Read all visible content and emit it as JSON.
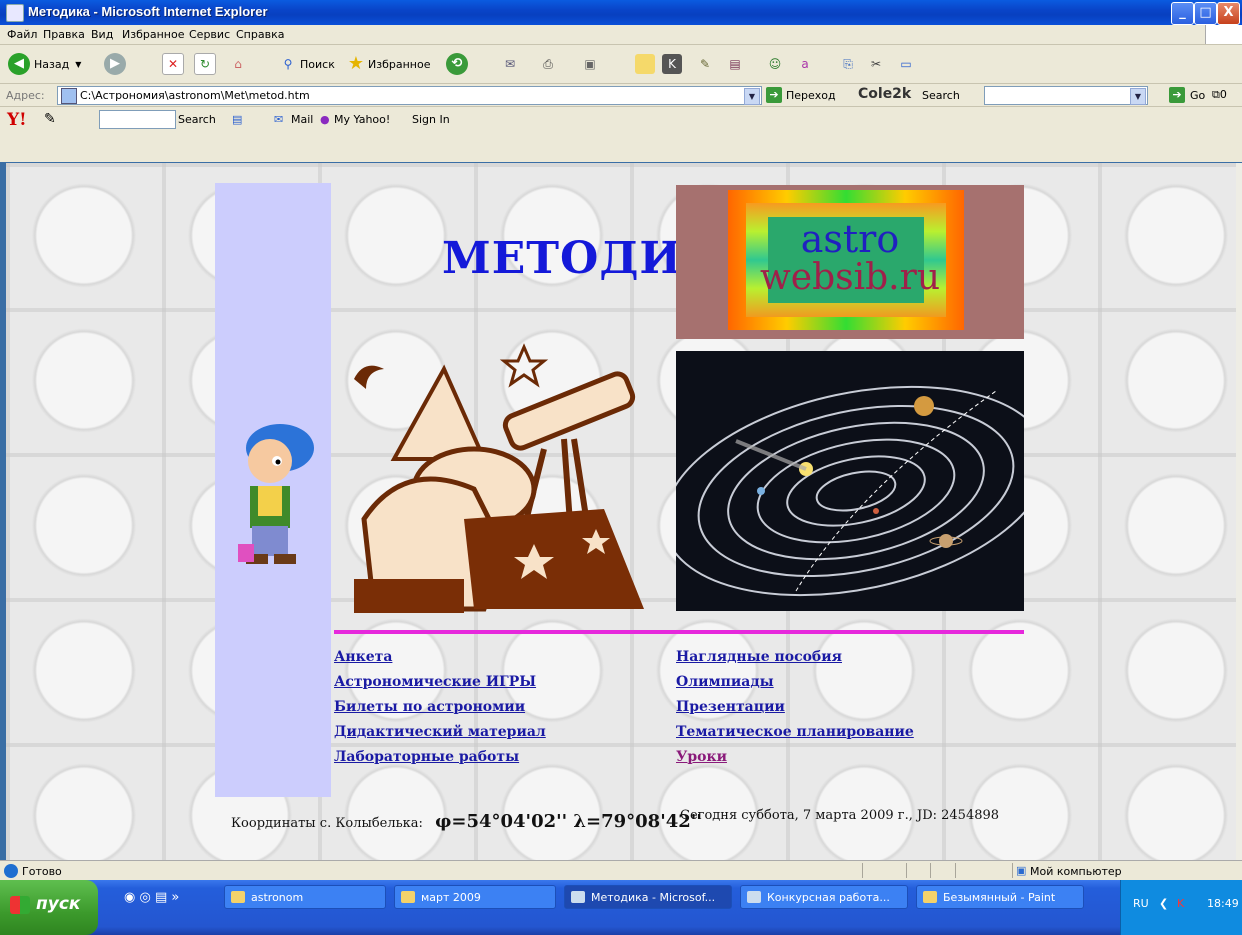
{
  "window": {
    "title": "Методика - Microsoft Internet Explorer",
    "minimize": "_",
    "maximize": "□",
    "close": "X"
  },
  "menu": [
    "Файл",
    "Правка",
    "Вид",
    "Избранное",
    "Сервис",
    "Справка"
  ],
  "toolbar": {
    "back": "Назад",
    "search": "Поиск",
    "favorites": "Избранное"
  },
  "address": {
    "label": "Адрес:",
    "url": "C:\\Астрономия\\astronom\\Met\\metod.htm",
    "go": "Переход",
    "brand": "Cole2k",
    "search_label": "Search",
    "go2": "Go"
  },
  "yahoo": {
    "logo": "Y!",
    "search": "Search",
    "mail": "Mail",
    "myyahoo": "My Yahoo!",
    "signin": "Sign In"
  },
  "page": {
    "heading": "МЕТОДИ",
    "logo_line1": "astro",
    "logo_line2": "websib.ru",
    "links_left": [
      "Анкета",
      "Астрономические ИГРЫ",
      "Билеты по астрономии",
      "Дидактический материал",
      "Лабораторные работы"
    ],
    "links_right": [
      "Наглядные пособия",
      "Олимпиады",
      "Презентации",
      "Тематическое планирование",
      "Уроки"
    ],
    "coords_label": "Координаты с. Колыбелька:",
    "coords_value": "φ=54°04'02'' λ=79°08'42''",
    "today": "Сегодня суббота, 7 марта 2009 г., JD: 2454898"
  },
  "status": {
    "text": "Готово",
    "zone": "Мой компьютер"
  },
  "taskbar": {
    "start": "пуск",
    "tasks": [
      "astronom",
      "март 2009",
      "Методика - Microsof...",
      "Конкурсная работа...",
      "Безымянный - Paint"
    ],
    "lang": "RU",
    "time": "18:49"
  }
}
